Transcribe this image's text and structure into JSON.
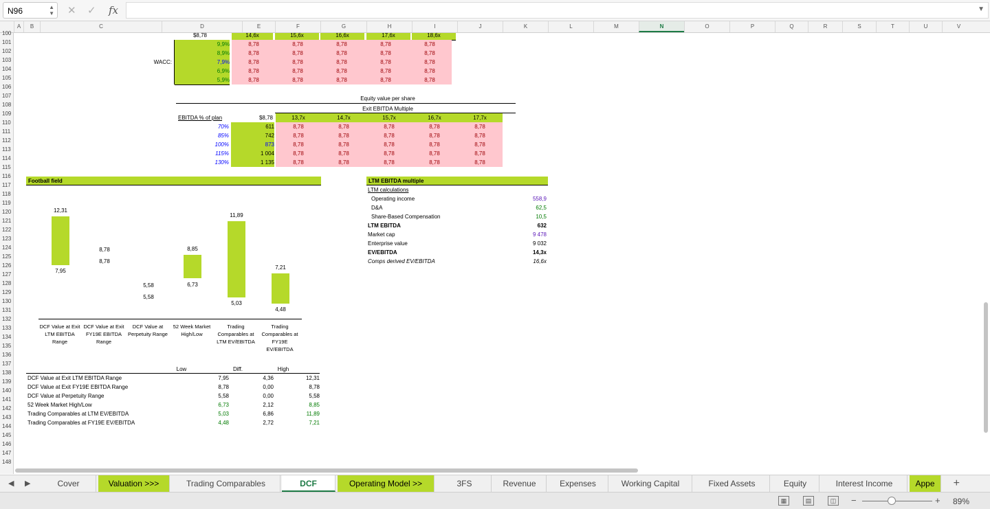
{
  "formula_bar": {
    "name_box": "N96",
    "cancel_icon": "✕",
    "enter_icon": "✓",
    "fx_label": "fx",
    "formula": ""
  },
  "columns": [
    "A",
    "B",
    "C",
    "D",
    "E",
    "F",
    "G",
    "H",
    "I",
    "J",
    "K",
    "L",
    "M",
    "N",
    "O",
    "P",
    "Q",
    "R",
    "S",
    "T",
    "U",
    "V"
  ],
  "selected_column": "N",
  "rows": [
    "100",
    "101",
    "102",
    "103",
    "104",
    "105",
    "106",
    "107",
    "108",
    "109",
    "110",
    "111",
    "112",
    "113",
    "114",
    "115",
    "116",
    "117",
    "118",
    "119",
    "120",
    "121",
    "122",
    "123",
    "124",
    "125",
    "126",
    "127",
    "128",
    "129",
    "130",
    "131",
    "132",
    "133",
    "134",
    "135",
    "136",
    "137",
    "138",
    "139",
    "140",
    "141",
    "142",
    "143",
    "144",
    "145",
    "146",
    "147",
    "148"
  ],
  "wacc_table": {
    "label": "WACC:",
    "top_row": [
      "$8,78",
      "14,6x",
      "15,6x",
      "16,6x",
      "17,6x",
      "18,6x"
    ],
    "rates": [
      "9,9%",
      "8,9%",
      "7,9%",
      "6,9%",
      "5,9%"
    ],
    "cells": [
      [
        "8,78",
        "8,78",
        "8,78",
        "8,78",
        "8,78"
      ],
      [
        "8,78",
        "8,78",
        "8,78",
        "8,78",
        "8,78"
      ],
      [
        "8,78",
        "8,78",
        "8,78",
        "8,78",
        "8,78"
      ],
      [
        "8,78",
        "8,78",
        "8,78",
        "8,78",
        "8,78"
      ],
      [
        "8,78",
        "8,78",
        "8,78",
        "8,78",
        "8,78"
      ]
    ]
  },
  "equity_table": {
    "title": "Equity value per share",
    "subtitle": "Exit EBITDA Multiple",
    "row_label": "EBITDA % of plan",
    "corner": "$8,78",
    "multiples": [
      "13,7x",
      "14,7x",
      "15,7x",
      "16,7x",
      "17,7x"
    ],
    "plans": [
      "70%",
      "85%",
      "100%",
      "115%",
      "130%"
    ],
    "ebitda": [
      "611",
      "742",
      "873",
      "1 004",
      "1 135"
    ],
    "cells": [
      [
        "8,78",
        "8,78",
        "8,78",
        "8,78",
        "8,78"
      ],
      [
        "8,78",
        "8,78",
        "8,78",
        "8,78",
        "8,78"
      ],
      [
        "8,78",
        "8,78",
        "8,78",
        "8,78",
        "8,78"
      ],
      [
        "8,78",
        "8,78",
        "8,78",
        "8,78",
        "8,78"
      ],
      [
        "8,78",
        "8,78",
        "8,78",
        "8,78",
        "8,78"
      ]
    ]
  },
  "football_field": {
    "title": "Football field",
    "bars": [
      {
        "label": "DCF Value at Exit LTM EBITDA Range",
        "low": "7,95",
        "high": "12,31"
      },
      {
        "label": "DCF Value at Exit FY19E EBITDA Range",
        "low": "8,78",
        "high": "8,78"
      },
      {
        "label": "DCF Value at Perpetuity Range",
        "low": "5,58",
        "high": "5,58"
      },
      {
        "label": "52 Week Market High/Low",
        "low": "6,73",
        "high": "8,85"
      },
      {
        "label": "Trading Comparables at LTM EV/EBITDA",
        "low": "5,03",
        "high": "11,89"
      },
      {
        "label": "Trading Comparables at FY19E EV/EBITDA",
        "low": "4,48",
        "high": "7,21"
      }
    ]
  },
  "ltm": {
    "title": "LTM EBITDA multiple",
    "subtitle": "LTM calculations",
    "items": [
      {
        "label": "Operating income",
        "value": "558,9"
      },
      {
        "label": "D&A",
        "value": "62,5"
      },
      {
        "label": "Share-Based Compensation",
        "value": "10,5"
      },
      {
        "label": "LTM EBITDA",
        "value": "632"
      },
      {
        "label": "Market cap",
        "value": "9 478"
      },
      {
        "label": "Enterprise value",
        "value": "9 032"
      },
      {
        "label": "EV/EBITDA",
        "value": "14,3x"
      },
      {
        "label": "Comps derived EV/EBITDA",
        "value": "16,6x"
      }
    ]
  },
  "summary": {
    "headers": {
      "low": "Low",
      "diff": "Diff.",
      "high": "High"
    },
    "rows": [
      {
        "label": "DCF Value at Exit LTM EBITDA Range",
        "low": "7,95",
        "diff": "4,36",
        "high": "12,31"
      },
      {
        "label": "DCF Value at Exit FY19E EBITDA Range",
        "low": "8,78",
        "diff": "0,00",
        "high": "8,78"
      },
      {
        "label": "DCF Value at Perpetuity Range",
        "low": "5,58",
        "diff": "0,00",
        "high": "5,58"
      },
      {
        "label": "52 Week Market High/Low",
        "low": "6,73",
        "diff": "2,12",
        "high": "8,85"
      },
      {
        "label": "Trading Comparables at LTM EV/EBITDA",
        "low": "5,03",
        "diff": "6,86",
        "high": "11,89"
      },
      {
        "label": "Trading Comparables at FY19E EV/EBITDA",
        "low": "4,48",
        "diff": "2,72",
        "high": "7,21"
      }
    ]
  },
  "sheet_tabs": [
    "Cover",
    "Valuation >>>",
    "Trading Comparables",
    "DCF",
    "Operating Model >>",
    "3FS",
    "Revenue",
    "Expenses",
    "Working Capital",
    "Fixed Assets",
    "Equity",
    "Interest Income",
    "Appe"
  ],
  "active_tab": "DCF",
  "status": {
    "zoom": "89%",
    "minus": "−",
    "plus": "+"
  },
  "colors": {
    "accent": "#1d7a45",
    "highlight": "#b5d92a",
    "pink": "#ffc7ce"
  }
}
